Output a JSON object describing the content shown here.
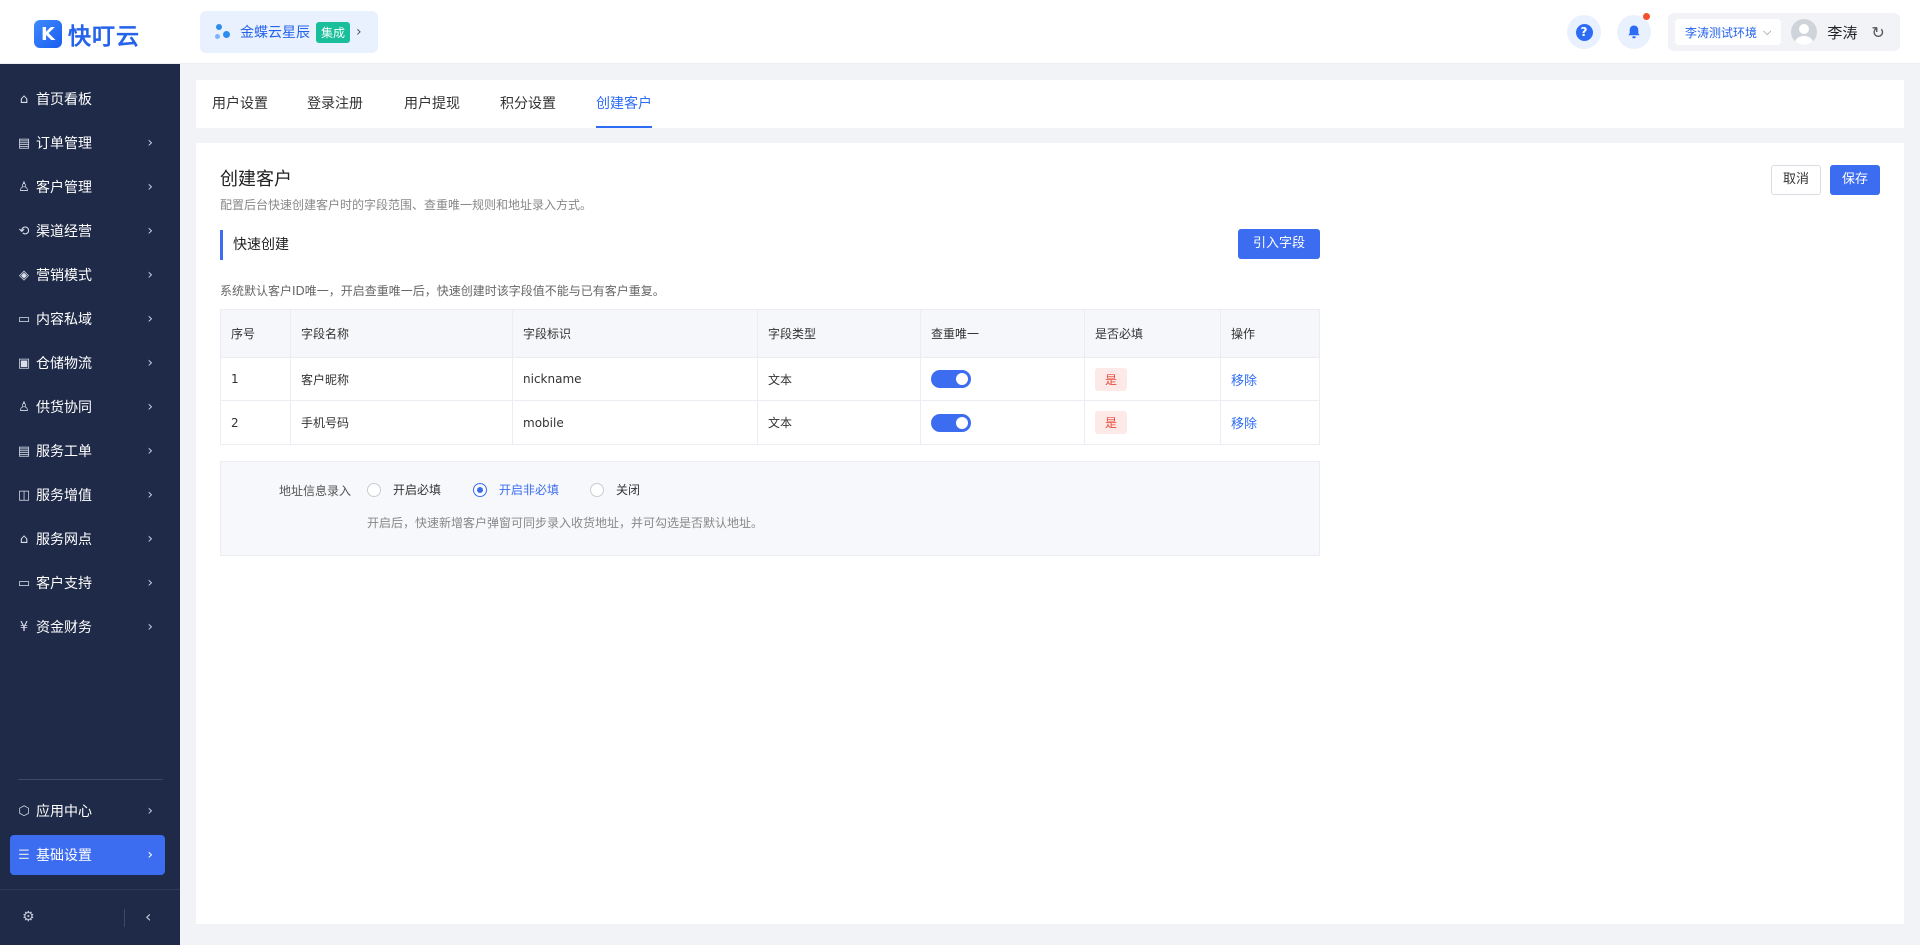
{
  "header": {
    "logo_mark": "K",
    "logo_text": "快叮云",
    "org_name": "金蝶云星辰",
    "org_badge": "集成",
    "help_glyph": "?",
    "env_label": "李涛测试环境",
    "user_name": "李涛"
  },
  "sidebar": {
    "items": [
      {
        "label": "首页看板",
        "icon": "home-icon"
      },
      {
        "label": "订单管理",
        "icon": "clipboard-icon"
      },
      {
        "label": "客户管理",
        "icon": "user-icon"
      },
      {
        "label": "渠道经营",
        "icon": "channel-icon"
      },
      {
        "label": "营销模式",
        "icon": "tag-icon"
      },
      {
        "label": "内容私域",
        "icon": "image-icon"
      },
      {
        "label": "仓储物流",
        "icon": "box-icon"
      },
      {
        "label": "供货协同",
        "icon": "team-icon"
      },
      {
        "label": "服务工单",
        "icon": "ticket-icon"
      },
      {
        "label": "服务增值",
        "icon": "bag-icon"
      },
      {
        "label": "服务网点",
        "icon": "store-icon"
      },
      {
        "label": "客户支持",
        "icon": "support-icon"
      },
      {
        "label": "资金财务",
        "icon": "yen-icon"
      }
    ],
    "bottom_items": [
      {
        "label": "应用中心",
        "icon": "cube-icon"
      },
      {
        "label": "基础设置",
        "icon": "settings-sliders-icon"
      }
    ]
  },
  "tabs": [
    "用户设置",
    "登录注册",
    "用户提现",
    "积分设置",
    "创建客户"
  ],
  "page": {
    "title": "创建客户",
    "description": "配置后台快速创建客户时的字段范围、查重唯一规则和地址录入方式。",
    "cancel_label": "取消",
    "save_label": "保存",
    "section_title": "快速创建",
    "import_label": "引入字段",
    "hint": "系统默认客户ID唯一，开启查重唯一后，快速创建时该字段值不能与已有客户重复。"
  },
  "table": {
    "headers": [
      "序号",
      "字段名称",
      "字段标识",
      "字段类型",
      "查重唯一",
      "是否必填",
      "操作"
    ],
    "rows": [
      {
        "index": "1",
        "name": "客户昵称",
        "key": "nickname",
        "type": "文本",
        "unique": true,
        "required": "是",
        "action": "移除"
      },
      {
        "index": "2",
        "name": "手机号码",
        "key": "mobile",
        "type": "文本",
        "unique": true,
        "required": "是",
        "action": "移除"
      }
    ]
  },
  "address": {
    "label": "地址信息录入",
    "options": [
      "开启必填",
      "开启非必填",
      "关闭"
    ],
    "selected": "开启非必填",
    "note": "开启后，快速新增客户弹窗可同步录入收货地址，并可勾选是否默认地址。"
  },
  "colors": {
    "primary": "#3c6df0",
    "sidebar_bg": "#1e2a47",
    "required_bg": "#fde9e7",
    "required_text": "#e84a3a"
  }
}
